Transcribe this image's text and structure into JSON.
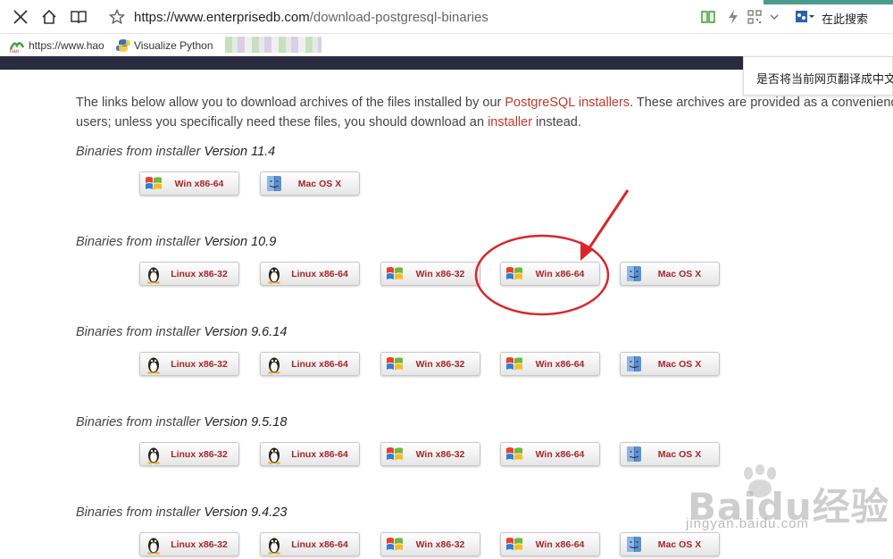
{
  "browser": {
    "url_host": "https://www.enterprisedb.com",
    "url_path": "/download-postgresql-binaries",
    "search_label": "在此搜索"
  },
  "bookmarks": [
    {
      "label": "https://www.hao"
    },
    {
      "label": "Visualize Python"
    }
  ],
  "translate_prompt": "是否将当前网页翻译成中文",
  "intro": {
    "line1_a": "The links below allow you to download archives of the files installed by our ",
    "line1_link": "PostgreSQL installers",
    "line1_b": ". These archives are provided as a convenienc",
    "line2_a": "users; unless you specifically need these files, you should download an ",
    "line2_link": "installer",
    "line2_b": " instead."
  },
  "sections": [
    {
      "label": "Binaries from installer",
      "version": "Version 11.4",
      "buttons": [
        {
          "label": "Win x86-64",
          "os": "windows"
        },
        {
          "label": "Mac OS X",
          "os": "mac"
        }
      ]
    },
    {
      "label": "Binaries from installer",
      "version": "Version 10.9",
      "buttons": [
        {
          "label": "Linux x86-32",
          "os": "linux"
        },
        {
          "label": "Linux x86-64",
          "os": "linux"
        },
        {
          "label": "Win x86-32",
          "os": "windows"
        },
        {
          "label": "Win x86-64",
          "os": "windows",
          "highlighted": true
        },
        {
          "label": "Mac OS X",
          "os": "mac"
        }
      ]
    },
    {
      "label": "Binaries from installer",
      "version": "Version 9.6.14",
      "buttons": [
        {
          "label": "Linux x86-32",
          "os": "linux"
        },
        {
          "label": "Linux x86-64",
          "os": "linux"
        },
        {
          "label": "Win x86-32",
          "os": "windows"
        },
        {
          "label": "Win x86-64",
          "os": "windows"
        },
        {
          "label": "Mac OS X",
          "os": "mac"
        }
      ]
    },
    {
      "label": "Binaries from installer",
      "version": "Version 9.5.18",
      "buttons": [
        {
          "label": "Linux x86-32",
          "os": "linux"
        },
        {
          "label": "Linux x86-64",
          "os": "linux"
        },
        {
          "label": "Win x86-32",
          "os": "windows"
        },
        {
          "label": "Win x86-64",
          "os": "windows"
        },
        {
          "label": "Mac OS X",
          "os": "mac"
        }
      ]
    },
    {
      "label": "Binaries from installer",
      "version": "Version 9.4.23",
      "buttons": [
        {
          "label": "Linux x86-32",
          "os": "linux"
        },
        {
          "label": "Linux x86-64",
          "os": "linux"
        },
        {
          "label": "Win x86-32",
          "os": "windows"
        },
        {
          "label": "Win x86-64",
          "os": "windows"
        },
        {
          "label": "Mac OS X",
          "os": "mac"
        }
      ]
    }
  ],
  "watermark": {
    "logo_text": "Baidu经验",
    "site": "jingyan.baidu.com"
  },
  "colors": {
    "link": "#c0392b",
    "button_text": "#a4242a",
    "annotation": "#d9262a",
    "navbar": "#2a2a40"
  }
}
